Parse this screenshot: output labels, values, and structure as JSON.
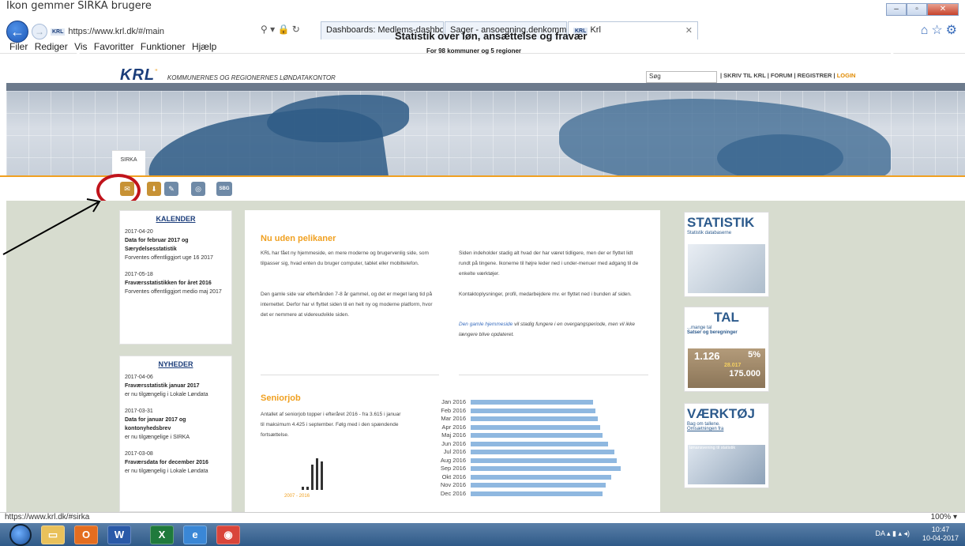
{
  "annotation": "Ikon gemmer SIRKA brugere",
  "browser": {
    "url": "https://www.krl.dk/#/main",
    "tabs": [
      {
        "label": "Dashboards: Medlems-dashbo..."
      },
      {
        "label": "Sager - ansoegning.denkomm..."
      },
      {
        "label": "Krl"
      }
    ],
    "menu": [
      "Filer",
      "Rediger",
      "Vis",
      "Favoritter",
      "Funktioner",
      "Hjælp"
    ],
    "status_url": "https://www.krl.dk/#sirka",
    "zoom": "100%"
  },
  "site": {
    "logo": "KRL",
    "logo_full": "KOMMUNERNES OG REGIONERNES LØNDATAKONTOR",
    "search_placeholder": "Søg",
    "toplinks": "| SKRIV TIL KRL | FORUM | REGISTRER |",
    "login": "LOGIN"
  },
  "banner": {
    "title": "Statistik over løn, ansættelse og fravær",
    "subtitle": "For 98 kommuner og 5 regioner"
  },
  "sirka_tab": "SIRKA",
  "icons": [
    {
      "name": "sirka"
    },
    {
      "name": "download"
    },
    {
      "name": "thought"
    },
    {
      "name": "help"
    },
    {
      "name": "SBG"
    }
  ],
  "kalender": {
    "title": "KALENDER",
    "items": [
      {
        "date": "2017-04-20",
        "title": "Data for februar 2017 og Særydelsesstatistik",
        "note": "Forventes offentliggjort uge 16 2017"
      },
      {
        "date": "2017-05-18",
        "title": "Fraværsstatistikken for året 2016",
        "note": "Forventes offentliggjort medio maj 2017"
      }
    ]
  },
  "nyheder": {
    "title": "NYHEDER",
    "items": [
      {
        "date": "2017-04-06",
        "title": "Fraværsstatistik januar 2017",
        "note": "er nu tilgængelig i Lokale Løndata"
      },
      {
        "date": "2017-03-31",
        "title": "Data for januar 2017 og kontonyhedsbrev",
        "note": "er nu tilgængelige i SIRKA"
      },
      {
        "date": "2017-03-08",
        "title": "Fraværsdata for december 2016",
        "note": "er nu tilgængelig i Lokale Løndata"
      }
    ]
  },
  "main": {
    "h1": "Nu uden pelikaner",
    "p1": "KRL har fået ny hjemmeside, en mere moderne og brugervenlig side, som tilpasser sig, hvad enten du bruger computer, tablet eller mobiltelefon.",
    "p2": "Den gamle side var efterhånden 7-8 år gammel, og det er meget lang tid på internettet. Derfor har vi flyttet siden til en helt ny og moderne platform, hvor det er nemmere at videreudvikle siden.",
    "p3": "Siden indeholder stadig alt hvad der har været tidligere, men der er flyttet lidt rundt på tingene. Ikonerne til højre leder ned i under-menuer med adgang til de enkelte værktøjer.",
    "p4": "Kontaktoplysninger, profil, medarbejdere mv. er flyttet ned i bunden af siden.",
    "p5_link": "Den gamle hjemmeside",
    "p5_rest": " vil stadig fungere i en overgangsperiode, men vil ikke længere blive opdateret.",
    "h2": "Seniorjob",
    "p6": "Antallet af seniorjob topper i efteråret 2016 - fra 3.615 i januar til maksimum 4.425 i september. Følg med i den spændende fortsættelse.",
    "spark_caption": "2007 - 2016"
  },
  "chart_data": {
    "type": "bar",
    "categories": [
      "Jan 2016",
      "Feb 2016",
      "Mar 2016",
      "Apr 2016",
      "Maj 2016",
      "Jun 2016",
      "Jul 2016",
      "Aug 2016",
      "Sep 2016",
      "Okt 2016",
      "Nov 2016",
      "Dec 2016"
    ],
    "values": [
      3615,
      3690,
      3760,
      3830,
      3900,
      4050,
      4250,
      4300,
      4425,
      4150,
      3980,
      3900
    ],
    "color": "#8fb8e0"
  },
  "widgets": {
    "statistik": {
      "title": "STATISTIK",
      "sub": "Statistik databaserne"
    },
    "tal": {
      "title": "TAL",
      "sub1": "...mange tal",
      "sub2": "Satser og beregninger",
      "n1": "1.126",
      "n2": "5%",
      "n3": "28.017",
      "n4": "175.000"
    },
    "vaerktoj": {
      "title": "VÆRKTØJ",
      "sub1": "Bag om tallene.",
      "sub2": "Omsætningen fra",
      "sub3": "lønansvening til statistik"
    }
  },
  "taskbar": {
    "lang": "DA",
    "time": "10:47",
    "date": "10-04-2017"
  }
}
